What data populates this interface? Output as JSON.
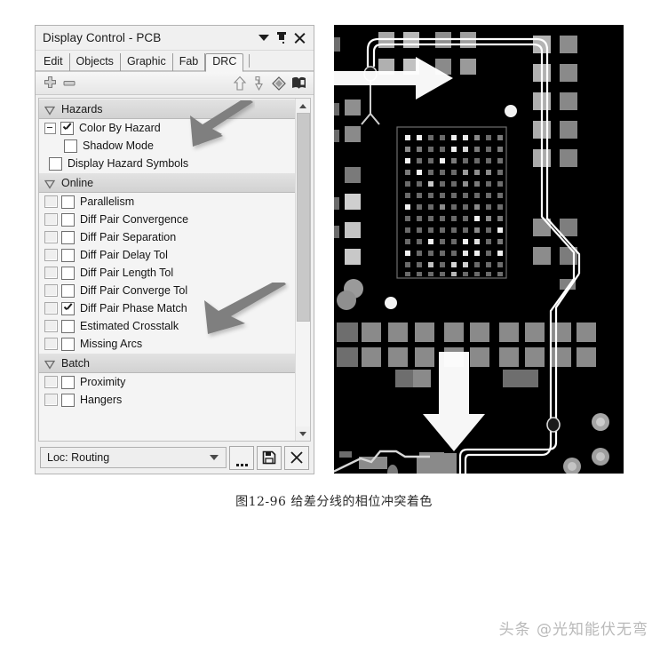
{
  "panel": {
    "title": "Display Control - PCB",
    "titlebar_buttons": [
      {
        "name": "dropdown-menu-button",
        "icon": "triangle-down-icon"
      },
      {
        "name": "pin-button",
        "icon": "pin-icon"
      },
      {
        "name": "close-button",
        "icon": "close-icon"
      }
    ],
    "tabs": [
      {
        "label": "Edit",
        "active": false
      },
      {
        "label": "Objects",
        "active": false
      },
      {
        "label": "Graphic",
        "active": false
      },
      {
        "label": "Fab",
        "active": false
      },
      {
        "label": "DRC",
        "active": true
      }
    ],
    "toolbar": {
      "left_icons": [
        "add-icon",
        "remove-icon"
      ],
      "right_icons": [
        "arrow-up-icon",
        "arrow-down-curved-icon",
        "diamond-icon",
        "book-icon"
      ]
    },
    "tree": [
      {
        "group": "Hazards",
        "items": [
          {
            "label": "Color By Hazard",
            "checked": true,
            "expander": true,
            "swatch": false,
            "indent": 0
          },
          {
            "label": "Shadow Mode",
            "checked": false,
            "expander": false,
            "swatch": false,
            "indent": 1
          },
          {
            "label": "Display Hazard Symbols",
            "checked": false,
            "expander": false,
            "swatch": false,
            "indent": 2
          }
        ]
      },
      {
        "group": "Online",
        "items": [
          {
            "label": "Parallelism",
            "checked": false,
            "expander": false,
            "swatch": true,
            "indent": 0
          },
          {
            "label": "Diff Pair Convergence",
            "checked": false,
            "expander": false,
            "swatch": true,
            "indent": 0
          },
          {
            "label": "Diff Pair Separation",
            "checked": false,
            "expander": false,
            "swatch": true,
            "indent": 0
          },
          {
            "label": "Diff Pair Delay Tol",
            "checked": false,
            "expander": false,
            "swatch": true,
            "indent": 0
          },
          {
            "label": "Diff Pair Length Tol",
            "checked": false,
            "expander": false,
            "swatch": true,
            "indent": 0
          },
          {
            "label": "Diff Pair Converge Tol",
            "checked": false,
            "expander": false,
            "swatch": true,
            "indent": 0
          },
          {
            "label": "Diff Pair Phase Match",
            "checked": true,
            "expander": false,
            "swatch": true,
            "indent": 0
          },
          {
            "label": "Estimated Crosstalk",
            "checked": false,
            "expander": false,
            "swatch": true,
            "indent": 0
          },
          {
            "label": "Missing Arcs",
            "checked": false,
            "expander": false,
            "swatch": true,
            "indent": 0
          }
        ]
      },
      {
        "group": "Batch",
        "items": [
          {
            "label": "Proximity",
            "checked": false,
            "expander": false,
            "swatch": true,
            "indent": 0
          },
          {
            "label": "Hangers",
            "checked": false,
            "expander": false,
            "swatch": true,
            "indent": 0
          }
        ]
      }
    ],
    "scrollbar": {
      "up": "chevron-up-icon",
      "down": "chevron-down-icon",
      "thumb_percent": 66
    },
    "bottom": {
      "combo_value": "Loc: Routing",
      "buttons": [
        {
          "name": "more-options-button",
          "icon": "ellipsis-icon"
        },
        {
          "name": "save-button",
          "icon": "floppy-disk-icon"
        },
        {
          "name": "delete-button",
          "icon": "close-icon"
        }
      ]
    }
  },
  "pcb": {
    "alt": "PCB layout with BGA pad array and a routed differential pair highlighted",
    "colors": {
      "background": "#000000",
      "trace": "#ffffff",
      "pad_light": "#cfcfcf",
      "pad_mid": "#8f8f8f",
      "pad_dark": "#5e5e5e",
      "outline": "#6d6d6d"
    },
    "bga": {
      "cols": 9,
      "rows": 13
    }
  },
  "annotations": {
    "color": "#7f7f7f",
    "arrows": [
      {
        "name": "arrow-to-color-by-hazard",
        "target": "Color By Hazard"
      },
      {
        "name": "arrow-to-diff-pair-phase-match",
        "target": "Diff Pair Phase Match"
      }
    ],
    "overlay_arrows": [
      {
        "name": "pcb-arrow-right",
        "direction": "right"
      },
      {
        "name": "pcb-arrow-down",
        "direction": "down"
      }
    ]
  },
  "caption": "图12-96  给差分线的相位冲突着色",
  "watermark": "头条 @光知能伏无弯"
}
